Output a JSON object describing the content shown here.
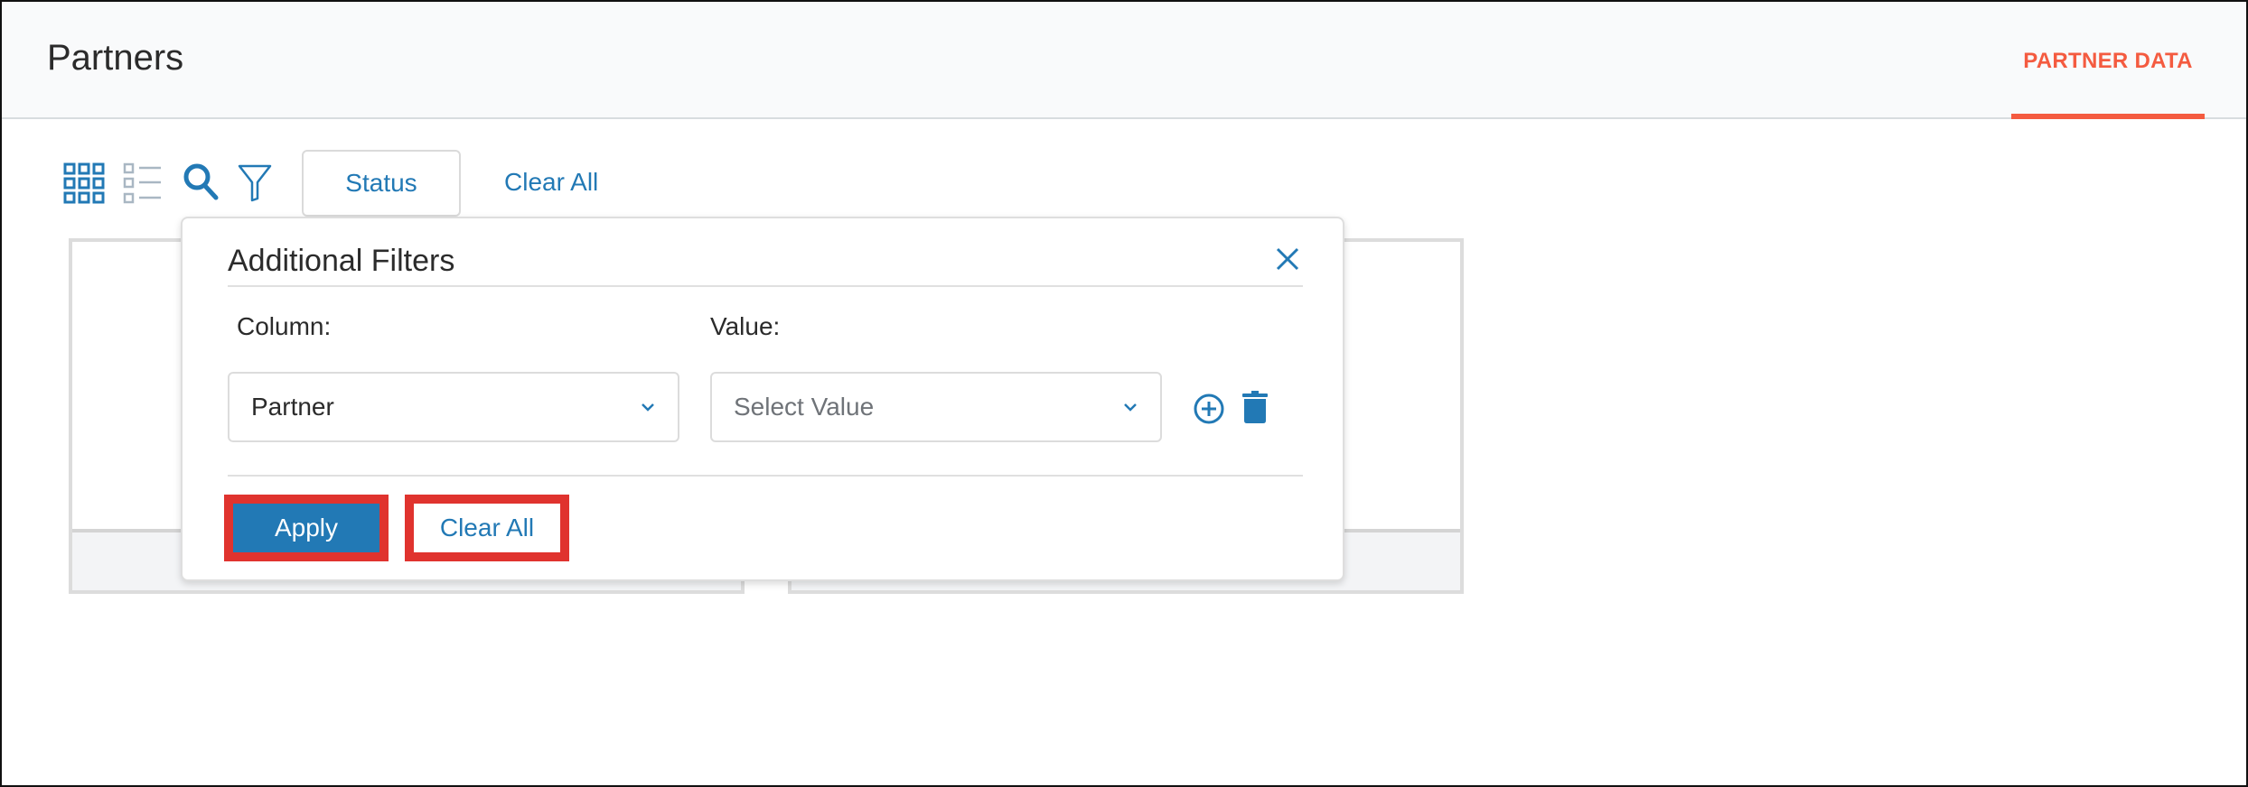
{
  "header": {
    "title": "Partners",
    "tabs": [
      {
        "label": "PARTNER DATA",
        "active": true
      }
    ],
    "accent_color": "#f45b40"
  },
  "toolbar": {
    "icons": [
      "grid-view-icon",
      "list-view-icon",
      "search-icon",
      "filter-icon"
    ],
    "status_label": "Status",
    "clear_all_label": "Clear All"
  },
  "popup": {
    "title": "Additional Filters",
    "column_label": "Column:",
    "value_label": "Value:",
    "column_value": "Partner",
    "value_placeholder": "Select Value",
    "apply_label": "Apply",
    "clear_all_label": "Clear All",
    "primary_color": "#2279b5",
    "highlight_color": "#e0332e"
  }
}
